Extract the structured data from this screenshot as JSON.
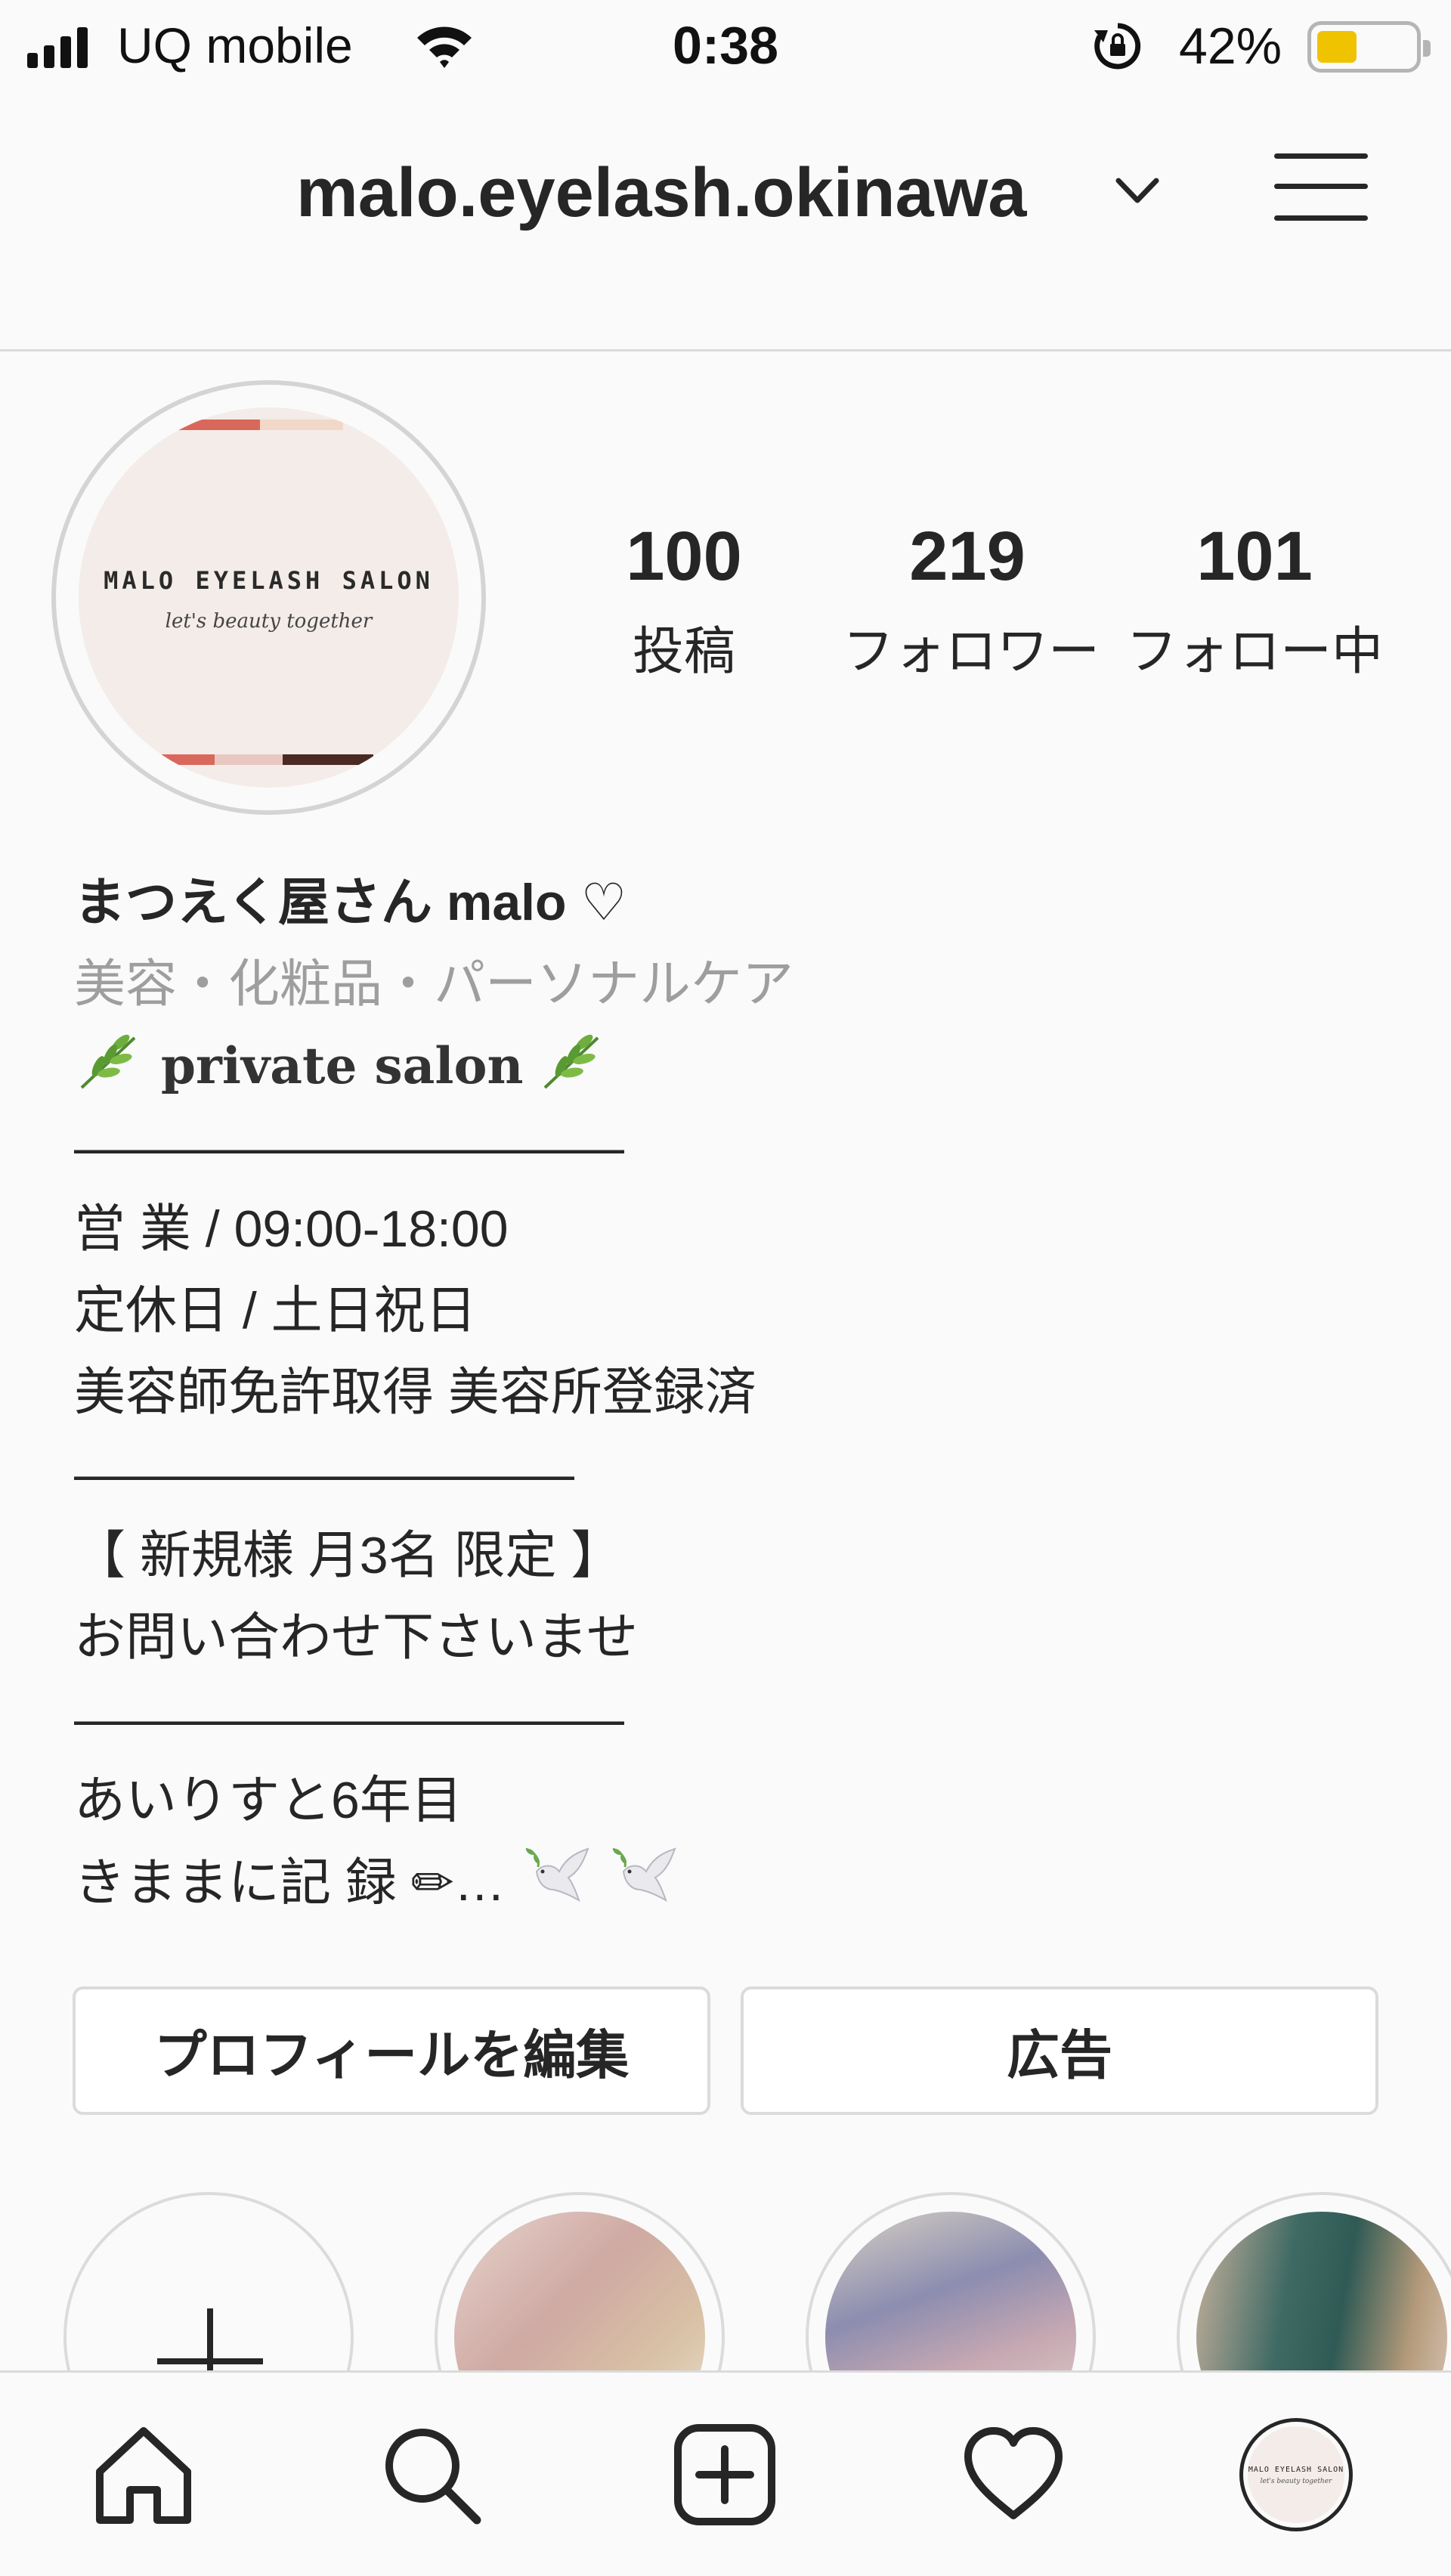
{
  "status_bar": {
    "carrier": "UQ mobile",
    "time": "0:38",
    "battery_percent": "42%",
    "battery_level": 0.42,
    "battery_color": "#f0c300"
  },
  "header": {
    "username": "malo.eyelash.okinawa",
    "dropdown_icon": "chevron-down-icon",
    "menu_icon": "hamburger-menu-icon"
  },
  "profile": {
    "avatar": {
      "logo_title": "MALO EYELASH SALON",
      "logo_tagline": "let's beauty together"
    },
    "stats": [
      {
        "count": "100",
        "label": "投稿"
      },
      {
        "count": "219",
        "label": "フォロワー"
      },
      {
        "count": "101",
        "label": "フォロー中"
      }
    ]
  },
  "bio": {
    "display_name": "まつえく屋さん malo ♡",
    "category": "美容・化粧品・パーソナルケア",
    "lines": [
      "private salon",
      "———————————",
      "営 業 / 09:00-18:00",
      "定休日 / 土日祝日",
      "美容師免許取得 美容所登録済",
      "——————————",
      "【 新規様 月3名 限定 】",
      "お問い合わせ下さいませ",
      "———————————",
      "あいりすと6年目",
      "きままに記 録 ✏…"
    ]
  },
  "buttons": {
    "edit_profile": "プロフィールを編集",
    "ad": "広告"
  },
  "highlights": {
    "new_icon": "plus-icon",
    "items": [
      "dried-flowers-highlight",
      "blue-flowers-highlight",
      "salon-interior-highlight"
    ]
  },
  "tab_bar": {
    "items": [
      "home-icon",
      "search-icon",
      "new-post-icon",
      "heart-icon",
      "profile-avatar"
    ]
  },
  "colors": {
    "text": "#262626",
    "muted": "#9e9e9e",
    "border": "#dbdbdb",
    "background": "#fafafa"
  }
}
